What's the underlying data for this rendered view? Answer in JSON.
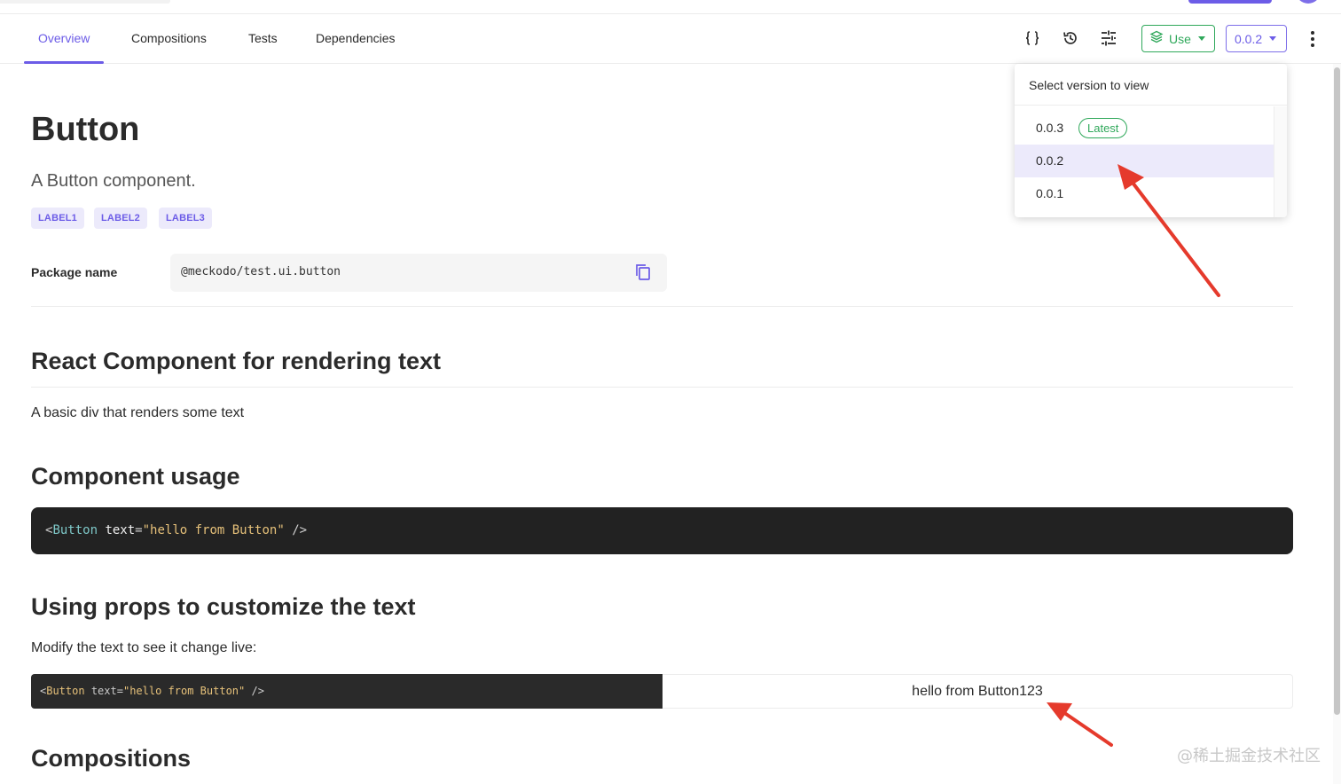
{
  "tabs": [
    {
      "label": "Overview",
      "active": true
    },
    {
      "label": "Compositions",
      "active": false
    },
    {
      "label": "Tests",
      "active": false
    },
    {
      "label": "Dependencies",
      "active": false
    }
  ],
  "toolbar": {
    "icons": [
      "code-braces-icon",
      "history-icon",
      "settings-sliders-icon"
    ],
    "use_label": "Use",
    "version_label": "0.0.2",
    "more_icon": "more-vertical-icon"
  },
  "version_dropdown": {
    "title": "Select version to view",
    "items": [
      {
        "label": "0.0.3",
        "badge": "Latest"
      },
      {
        "label": "0.0.2",
        "selected": true
      },
      {
        "label": "0.0.1"
      }
    ]
  },
  "component": {
    "title": "Button",
    "description": "A Button component.",
    "labels": [
      "LABEL1",
      "LABEL2",
      "LABEL3"
    ],
    "package_label": "Package name",
    "package_name": "@meckodo/test.ui.button"
  },
  "sections": {
    "react_heading": "React Component for rendering text",
    "react_text": "A basic div that renders some text",
    "usage_heading": "Component usage",
    "usage_code": {
      "open": "<",
      "tag": "Button",
      "attr": "text",
      "eq": "=",
      "value": "\"hello from Button\"",
      "close": " />"
    },
    "props_heading": "Using props to customize the text",
    "props_text": "Modify the text to see it change live:",
    "live_code": {
      "open": "<",
      "tag": "Button",
      "attr": "text",
      "eq": "=",
      "value": "\"hello from Button\"",
      "close": " />"
    },
    "live_preview": "hello from Button123",
    "compositions_heading": "Compositions"
  },
  "watermark": "@稀土掘金技术社区",
  "colors": {
    "accent": "#6c5ce7",
    "success": "#2fa85a",
    "code_bg": "#222222",
    "annotation": "#e53a2c"
  }
}
